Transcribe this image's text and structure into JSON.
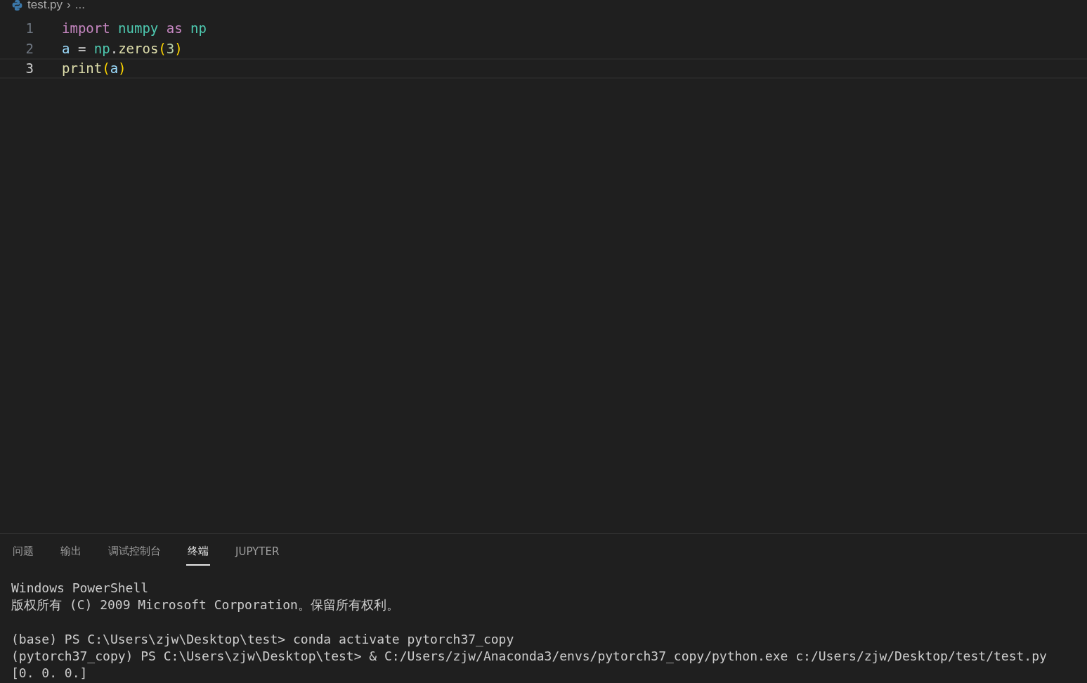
{
  "breadcrumb": {
    "file": "test.py",
    "separator": "›",
    "rest": "..."
  },
  "editor": {
    "lines": [
      {
        "number": "1",
        "current": false,
        "tokens": [
          {
            "kind": "keyword",
            "text": "import"
          },
          {
            "kind": "module",
            "text": " numpy"
          },
          {
            "kind": "keyword",
            "text": " as"
          },
          {
            "kind": "module",
            "text": " np"
          }
        ]
      },
      {
        "number": "2",
        "current": false,
        "tokens": [
          {
            "kind": "variable",
            "text": "a"
          },
          {
            "kind": "plain",
            "text": " = "
          },
          {
            "kind": "module",
            "text": "np"
          },
          {
            "kind": "plain",
            "text": "."
          },
          {
            "kind": "function",
            "text": "zeros"
          },
          {
            "kind": "bracket",
            "text": "("
          },
          {
            "kind": "number",
            "text": "3"
          },
          {
            "kind": "bracket",
            "text": ")"
          }
        ]
      },
      {
        "number": "3",
        "current": true,
        "tokens": [
          {
            "kind": "function",
            "text": "print"
          },
          {
            "kind": "bracket",
            "text": "("
          },
          {
            "kind": "variable",
            "text": "a"
          },
          {
            "kind": "bracket",
            "text": ")"
          }
        ]
      }
    ]
  },
  "panel": {
    "tabs": [
      {
        "label": "问题",
        "selected": false
      },
      {
        "label": "输出",
        "selected": false
      },
      {
        "label": "调试控制台",
        "selected": false
      },
      {
        "label": "终端",
        "selected": true
      },
      {
        "label": "JUPYTER",
        "selected": false
      }
    ],
    "terminal": {
      "blocks": [
        [
          "Windows PowerShell",
          "版权所有 (C) 2009 Microsoft Corporation。保留所有权利。"
        ],
        [
          "(base) PS C:\\Users\\zjw\\Desktop\\test> conda activate pytorch37_copy",
          "(pytorch37_copy) PS C:\\Users\\zjw\\Desktop\\test> & C:/Users/zjw/Anaconda3/envs/pytorch37_copy/python.exe c:/Users/zjw/Desktop/test/test.py",
          "[0. 0. 0.]"
        ]
      ]
    }
  }
}
